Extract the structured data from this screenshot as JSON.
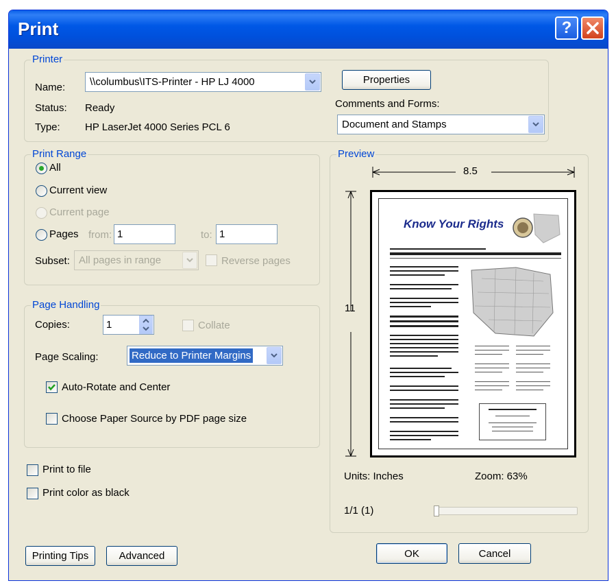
{
  "window": {
    "title": "Print"
  },
  "printer": {
    "legend": "Printer",
    "name_label": "Name:",
    "name_value": "\\\\columbus\\ITS-Printer - HP LJ 4000",
    "status_label": "Status:",
    "status_value": "Ready",
    "type_label": "Type:",
    "type_value": "HP LaserJet 4000 Series PCL 6",
    "properties_label": "Properties",
    "comments_label": "Comments and Forms:",
    "comments_value": "Document and Stamps"
  },
  "print_range": {
    "legend": "Print Range",
    "all_label": "All",
    "current_view_label": "Current view",
    "current_page_label": "Current page",
    "pages_label": "Pages",
    "from_label": "from:",
    "from_value": "1",
    "to_label": "to:",
    "to_value": "1",
    "subset_label": "Subset:",
    "subset_value": "All pages in range",
    "reverse_label": "Reverse pages",
    "selected": "All"
  },
  "page_handling": {
    "legend": "Page Handling",
    "copies_label": "Copies:",
    "copies_value": "1",
    "collate_label": "Collate",
    "scaling_label": "Page Scaling:",
    "scaling_value": "Reduce to Printer Margins",
    "autorotate_label": "Auto-Rotate and Center",
    "autorotate_checked": true,
    "paper_source_label": "Choose Paper Source by PDF page size",
    "paper_source_checked": false
  },
  "options": {
    "print_to_file_label": "Print to file",
    "print_color_black_label": "Print color as black"
  },
  "preview": {
    "legend": "Preview",
    "width_label": "8.5",
    "height_label": "11",
    "units_label": "Units: Inches",
    "zoom_label": "Zoom:  63%",
    "page_indicator": "1/1 (1)",
    "document_title": "Know Your Rights"
  },
  "buttons": {
    "printing_tips": "Printing Tips",
    "advanced": "Advanced",
    "ok": "OK",
    "cancel": "Cancel"
  },
  "colors": {
    "title_bar": "#0058e6",
    "legend_text": "#0046d5",
    "dialog_bg": "#ece9d8"
  }
}
